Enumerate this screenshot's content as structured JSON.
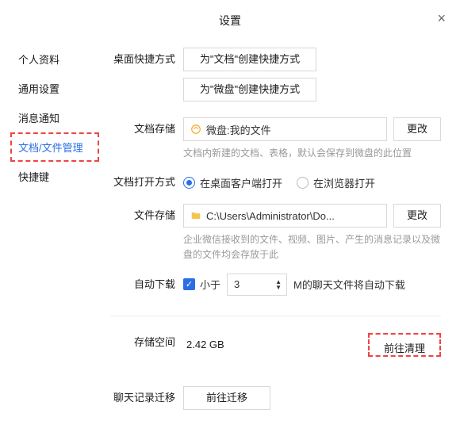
{
  "header": {
    "title": "设置"
  },
  "sidebar": {
    "items": [
      {
        "label": "个人资料"
      },
      {
        "label": "通用设置"
      },
      {
        "label": "消息通知"
      },
      {
        "label": "文档/文件管理"
      },
      {
        "label": "快捷键"
      }
    ]
  },
  "shortcut": {
    "label": "桌面快捷方式",
    "btn_doc": "为\"文档\"创建快捷方式",
    "btn_drive": "为\"微盘\"创建快捷方式"
  },
  "doc_storage": {
    "label": "文档存储",
    "path": "微盘:我的文件",
    "change": "更改",
    "hint": "文档内新建的文档、表格，默认会保存到微盘的此位置"
  },
  "open_mode": {
    "label": "文档打开方式",
    "opt_desktop": "在桌面客户端打开",
    "opt_browser": "在浏览器打开"
  },
  "file_storage": {
    "label": "文件存储",
    "path": "C:\\Users\\Administrator\\Do...",
    "change": "更改",
    "hint": "企业微信接收到的文件、视频、图片、产生的消息记录以及微盘的文件均会存放于此"
  },
  "auto_dl": {
    "label": "自动下载",
    "lt": "小于",
    "value": "3",
    "suffix": "M的聊天文件将自动下载"
  },
  "storage": {
    "label": "存储空间",
    "value": "2.42 GB",
    "clean": "前往清理"
  },
  "migrate": {
    "label": "聊天记录迁移",
    "btn": "前往迁移"
  }
}
